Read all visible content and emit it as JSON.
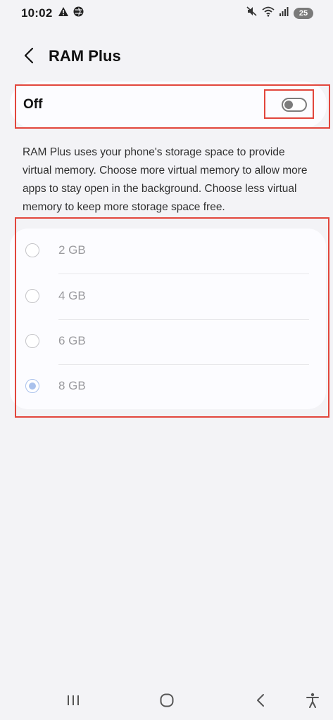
{
  "status_bar": {
    "time": "10:02",
    "battery": "25",
    "icons": [
      "warning-icon",
      "aperture-icon",
      "mute-icon",
      "wifi-icon",
      "signal-icon",
      "battery-icon"
    ]
  },
  "header": {
    "title": "RAM Plus",
    "back_icon": "back-arrow-icon"
  },
  "toggle": {
    "label": "Off",
    "state": "off"
  },
  "description": "RAM Plus uses your phone's storage space to provide virtual memory. Choose more virtual memory to allow more apps to stay open in the background. Choose less virtual memory to keep more storage space free.",
  "options": [
    {
      "label": "2 GB",
      "selected": false
    },
    {
      "label": "4 GB",
      "selected": false
    },
    {
      "label": "6 GB",
      "selected": false
    },
    {
      "label": "8 GB",
      "selected": true
    }
  ],
  "colors": {
    "background": "#f3f3f6",
    "card": "#fcfcff",
    "highlight": "#e2463c",
    "radio_selected": "#a9c1ec",
    "disabled_text": "#9a9a9e"
  },
  "nav_bar": {
    "icons": [
      "recent-apps-icon",
      "home-icon",
      "back-icon",
      "accessibility-icon"
    ]
  }
}
